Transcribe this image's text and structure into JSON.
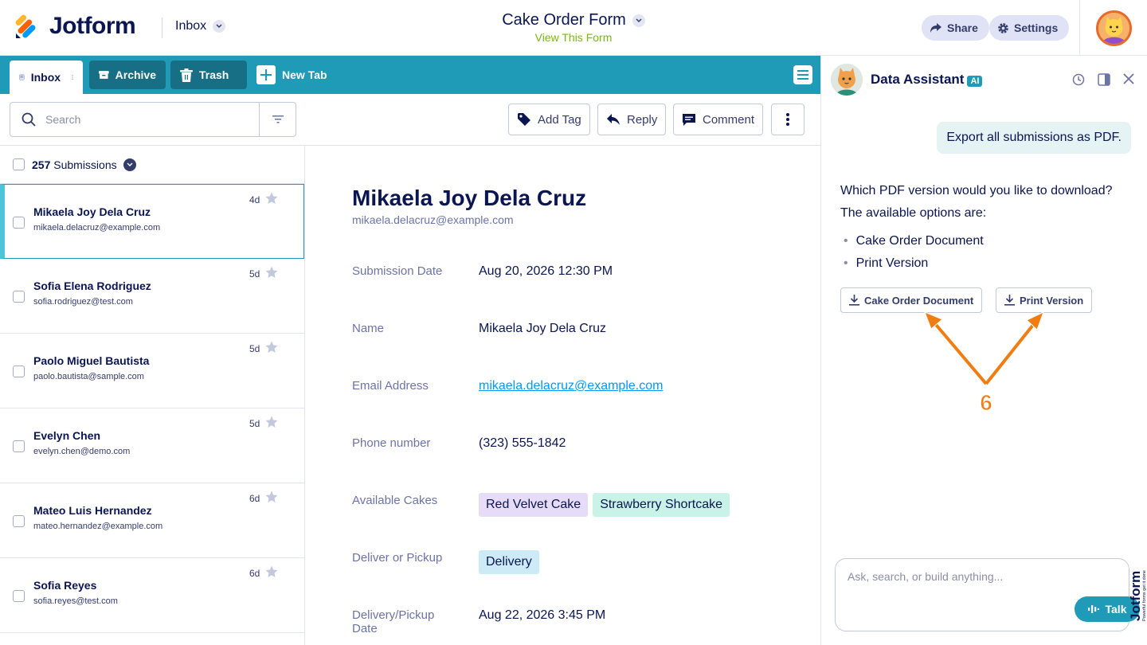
{
  "header": {
    "brand": "Jotform",
    "inbox_label": "Inbox",
    "form_title": "Cake Order Form",
    "view_form": "View This Form",
    "share": "Share",
    "settings": "Settings"
  },
  "tabs": [
    {
      "label": "Inbox"
    },
    {
      "label": "Archive"
    },
    {
      "label": "Trash"
    },
    {
      "label": "New Tab"
    }
  ],
  "toolbar": {
    "search_placeholder": "Search",
    "add_tag": "Add Tag",
    "reply": "Reply",
    "comment": "Comment"
  },
  "list": {
    "count": "257",
    "count_label": "Submissions",
    "items": [
      {
        "name": "Mikaela Joy Dela Cruz",
        "email": "mikaela.delacruz@example.com",
        "age": "4d"
      },
      {
        "name": "Sofia Elena Rodriguez",
        "email": "sofia.rodriguez@test.com",
        "age": "5d"
      },
      {
        "name": "Paolo Miguel Bautista",
        "email": "paolo.bautista@sample.com",
        "age": "5d"
      },
      {
        "name": "Evelyn Chen",
        "email": "evelyn.chen@demo.com",
        "age": "5d"
      },
      {
        "name": "Mateo Luis Hernandez",
        "email": "mateo.hernandez@example.com",
        "age": "6d"
      },
      {
        "name": "Sofia Reyes",
        "email": "sofia.reyes@test.com",
        "age": "6d"
      }
    ]
  },
  "detail": {
    "name": "Mikaela Joy Dela Cruz",
    "email": "mikaela.delacruz@example.com",
    "fields": [
      {
        "label": "Submission Date",
        "value": "Aug 20, 2026 12:30 PM"
      },
      {
        "label": "Name",
        "value": "Mikaela Joy Dela Cruz"
      },
      {
        "label": "Email Address",
        "value": "mikaela.delacruz@example.com"
      },
      {
        "label": "Phone number",
        "value": "(323) 555-1842"
      },
      {
        "label": "Available Cakes",
        "tags": [
          "Red Velvet Cake",
          "Strawberry Shortcake"
        ]
      },
      {
        "label": "Deliver or Pickup",
        "tags": [
          "Delivery"
        ]
      },
      {
        "label": "Delivery/Pickup Date",
        "value": "Aug 22, 2026 3:45 PM"
      }
    ]
  },
  "assistant": {
    "title": "Data Assistant",
    "badge": "AI",
    "user_message": "Export all submissions as PDF.",
    "reply_line1": "Which PDF version would you like to download?",
    "reply_line2": "The available options are:",
    "options": [
      "Cake Order Document",
      "Print Version"
    ],
    "buttons": [
      "Cake Order Document",
      "Print Version"
    ],
    "annotation_number": "6",
    "input_placeholder": "Ask, search, or build anything...",
    "talk": "Talk",
    "side_brand": "Jotform",
    "side_tagline": "Powerful forms get it done"
  },
  "colors": {
    "teal": "#1f9bb8",
    "navy": "#0a1551",
    "green_link": "#78bb07",
    "annotation_orange": "#f07d11",
    "tag_purple": "#e6dcf7",
    "tag_mint": "#c9f3e6",
    "tag_blue": "#cdeaf7"
  }
}
